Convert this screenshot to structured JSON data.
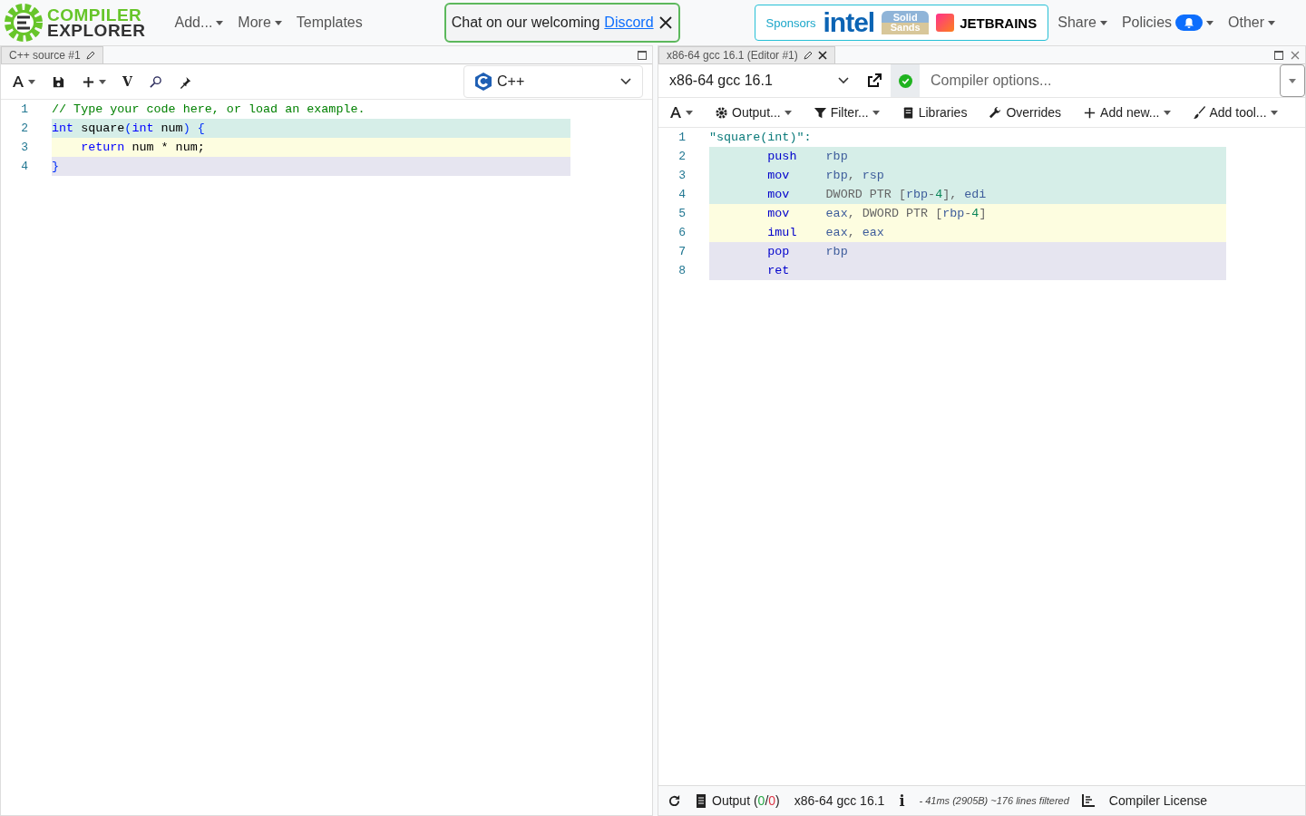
{
  "header": {
    "logo": [
      "COMPILER",
      "EXPLORER"
    ],
    "menu": [
      {
        "label": "Add...",
        "dropdown": true
      },
      {
        "label": "More",
        "dropdown": true
      },
      {
        "label": "Templates",
        "dropdown": false
      }
    ],
    "notice": {
      "text": "Chat on our welcoming",
      "link": "Discord"
    },
    "sponsors": {
      "label": "Sponsors",
      "logos": [
        {
          "text": "intel",
          "kind": "intel"
        },
        {
          "text": "Solid Sands",
          "kind": "solid"
        },
        {
          "text": "JETBRAINS",
          "kind": "jetbrains"
        }
      ]
    },
    "right_menu": [
      {
        "label": "Share",
        "badge": false
      },
      {
        "label": "Policies",
        "badge": true
      },
      {
        "label": "Other",
        "badge": false
      }
    ]
  },
  "source_pane": {
    "tab": "C++ source #1",
    "toolbar": [
      {
        "kind": "font"
      },
      {
        "kind": "save"
      },
      {
        "kind": "add"
      },
      {
        "kind": "vim",
        "text": "V"
      },
      {
        "kind": "search"
      },
      {
        "kind": "pin"
      }
    ],
    "language": "C++",
    "lines": [
      {
        "number": "1",
        "tokens": [
          {
            "text": "// Type your code here, or load an example.",
            "kind": "comment"
          }
        ]
      },
      {
        "number": "2",
        "color": "#d6eee8",
        "tokens": [
          {
            "text": "int",
            "kind": "keyword"
          },
          {
            "text": " square",
            "kind": "plain"
          },
          {
            "text": "(",
            "kind": "punct"
          },
          {
            "text": "int",
            "kind": "keyword"
          },
          {
            "text": " num",
            "kind": "plain"
          },
          {
            "text": ") {",
            "kind": "punct"
          }
        ]
      },
      {
        "number": "3",
        "color": "#fdfde0",
        "tokens": [
          {
            "text": "    return",
            "kind": "keyword"
          },
          {
            "text": " num * num;",
            "kind": "plain"
          }
        ]
      },
      {
        "number": "4",
        "color": "#e6e5f0",
        "tokens": [
          {
            "text": "}",
            "kind": "punct"
          }
        ]
      }
    ]
  },
  "compiler_pane": {
    "tab": "x86-64 gcc 16.1 (Editor #1)",
    "compiler": "x86-64 gcc 16.1",
    "options_placeholder": "Compiler options...",
    "toolbar": [
      {
        "kind": "font"
      },
      {
        "kind": "gear",
        "label": "Output...",
        "dropdown": true
      },
      {
        "kind": "filter",
        "label": "Filter...",
        "dropdown": true
      },
      {
        "kind": "book",
        "label": "Libraries",
        "dropdown": false
      },
      {
        "kind": "wrench",
        "label": "Overrides",
        "dropdown": false
      },
      {
        "kind": "plus",
        "label": "Add new...",
        "dropdown": true
      },
      {
        "kind": "brush",
        "label": "Add tool...",
        "dropdown": true
      }
    ],
    "lines": [
      {
        "number": "1",
        "tokens": [
          {
            "text": "\"square(int)\":",
            "kind": "label"
          }
        ]
      },
      {
        "number": "2",
        "color": "#d6eee8",
        "tokens": [
          {
            "text": "        push",
            "kind": "mnemonic"
          },
          {
            "text": "    rbp",
            "kind": "register"
          }
        ]
      },
      {
        "number": "3",
        "color": "#d6eee8",
        "tokens": [
          {
            "text": "        mov",
            "kind": "mnemonic"
          },
          {
            "text": "     rbp",
            "kind": "register"
          },
          {
            "text": ", ",
            "kind": "plain"
          },
          {
            "text": "rsp",
            "kind": "register"
          }
        ]
      },
      {
        "number": "4",
        "color": "#d6eee8",
        "tokens": [
          {
            "text": "        mov",
            "kind": "mnemonic"
          },
          {
            "text": "     DWORD PTR [",
            "kind": "plain"
          },
          {
            "text": "rbp",
            "kind": "register"
          },
          {
            "text": "-",
            "kind": "plain"
          },
          {
            "text": "4",
            "kind": "number"
          },
          {
            "text": "], ",
            "kind": "plain"
          },
          {
            "text": "edi",
            "kind": "register"
          }
        ]
      },
      {
        "number": "5",
        "color": "#fdfde0",
        "tokens": [
          {
            "text": "        mov",
            "kind": "mnemonic"
          },
          {
            "text": "     eax",
            "kind": "register"
          },
          {
            "text": ", DWORD PTR [",
            "kind": "plain"
          },
          {
            "text": "rbp",
            "kind": "register"
          },
          {
            "text": "-",
            "kind": "plain"
          },
          {
            "text": "4",
            "kind": "number"
          },
          {
            "text": "]",
            "kind": "plain"
          }
        ]
      },
      {
        "number": "6",
        "color": "#fdfde0",
        "tokens": [
          {
            "text": "        imul",
            "kind": "mnemonic"
          },
          {
            "text": "    eax",
            "kind": "register"
          },
          {
            "text": ", ",
            "kind": "plain"
          },
          {
            "text": "eax",
            "kind": "register"
          }
        ]
      },
      {
        "number": "7",
        "color": "#e6e5f0",
        "tokens": [
          {
            "text": "        pop",
            "kind": "mnemonic"
          },
          {
            "text": "     rbp",
            "kind": "register"
          }
        ]
      },
      {
        "number": "8",
        "color": "#e6e5f0",
        "tokens": [
          {
            "text": "        ret",
            "kind": "mnemonic"
          }
        ]
      }
    ],
    "status": {
      "output": [
        {
          "text": "Output (",
          "kind": "plain"
        },
        {
          "text": "0",
          "kind": "ok"
        },
        {
          "text": "/",
          "kind": "plain"
        },
        {
          "text": "0",
          "kind": "error"
        },
        {
          "text": ")",
          "kind": "plain"
        }
      ],
      "compiler": "x86-64 gcc 16.1",
      "info": "i",
      "timing": "- 41ms (2905B) ~176 lines filtered",
      "license": "Compiler License"
    }
  }
}
